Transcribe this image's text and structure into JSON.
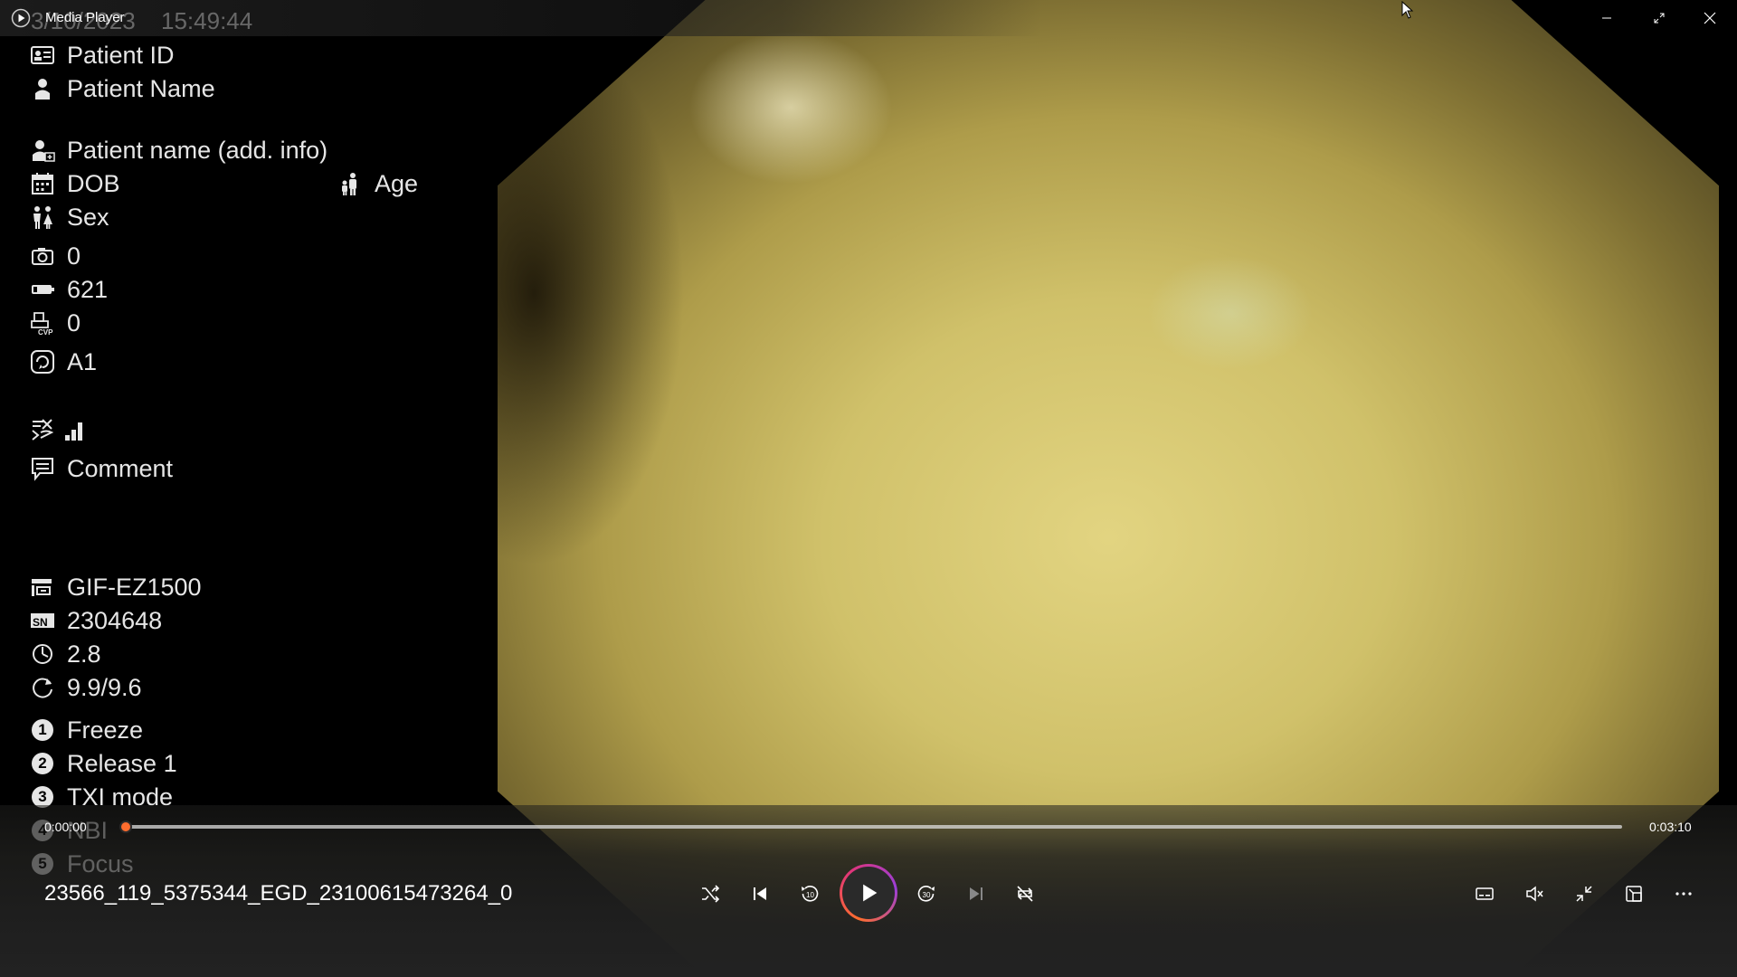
{
  "window": {
    "title": "Media Player",
    "minimize_icon": "minimize-icon",
    "restore_icon": "restore-icon",
    "close_icon": "close-icon"
  },
  "osd": {
    "date": "3/10/2023",
    "time": "15:49:44",
    "patient_id": "Patient ID",
    "patient_name": "Patient Name",
    "patient_name_add": "Patient name (add. info)",
    "dob": "DOB",
    "age": "Age",
    "sex": "Sex",
    "camera_count": "0",
    "battery_value": "621",
    "cvp_value": "0",
    "mode_value": "A1",
    "comment": "Comment",
    "scope_model": "GIF-EZ1500",
    "serial_number": "2304648",
    "value_a": "2.8",
    "value_b": "9.9/9.6",
    "buttons": [
      {
        "num": "1",
        "label": "Freeze"
      },
      {
        "num": "2",
        "label": "Release 1"
      },
      {
        "num": "3",
        "label": "TXI mode"
      },
      {
        "num": "4",
        "label": "NBI"
      },
      {
        "num": "5",
        "label": "Focus"
      }
    ]
  },
  "player": {
    "current_time": "0:00:00",
    "total_time": "0:03:10",
    "progress": 0.0,
    "file_name": "23566_119_5375344_EGD_23100615473264_0"
  },
  "colors": {
    "accent": "#ff6d2e",
    "accent2": "#9b3ed8",
    "scope": "#d4c46e"
  }
}
